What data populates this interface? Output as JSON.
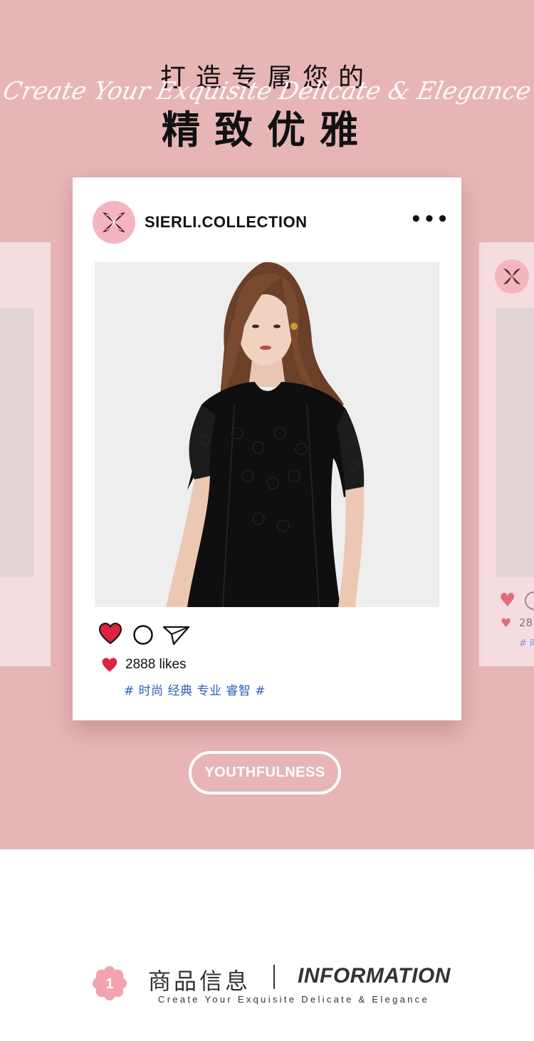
{
  "hero": {
    "title_line1": "打造专属您的",
    "script_text": "Create Your Exquisite Delicate & Elegance",
    "title_line2": "精致优雅",
    "background": "#e8b5b7"
  },
  "post": {
    "account_name": "SIERLI.COLLECTION",
    "more_icon": "•••",
    "likes_text": "2888 likes",
    "hashtags": "# 时尚 经典 专业 睿智 #",
    "heart_color": "#d9253f",
    "hashtag_color": "#2c5db8"
  },
  "side_card": {
    "likes_partial": "28",
    "tag_partial": "# 时"
  },
  "pill": {
    "label": "YOUTHFULNESS"
  },
  "info": {
    "number": "1",
    "title_cn": "商品信息",
    "separator": "|",
    "title_en": "INFORMATION",
    "subtitle": "Create Your Exquisite Delicate & Elegance"
  }
}
